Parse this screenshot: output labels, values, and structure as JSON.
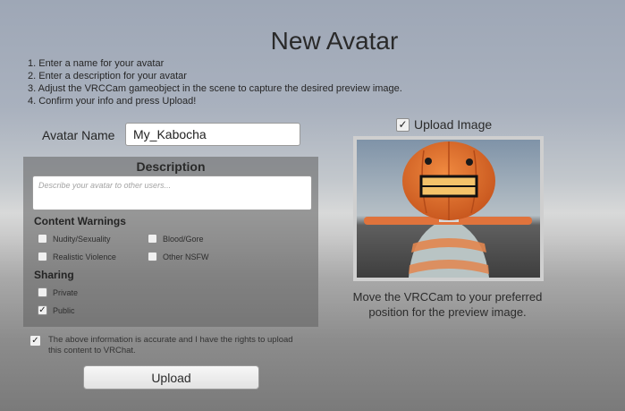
{
  "page": {
    "title": "New Avatar"
  },
  "instructions": [
    "1. Enter a name for your avatar",
    "2. Enter a description for your avatar",
    "3. Adjust the VRCCam gameobject in the scene to capture the desired preview image.",
    "4. Confirm your info and press Upload!"
  ],
  "avatar_name": {
    "label": "Avatar Name",
    "value": "My_Kabocha"
  },
  "description": {
    "title": "Description",
    "placeholder": "Describe your avatar to other users...",
    "value": ""
  },
  "content_warnings": {
    "label": "Content Warnings",
    "options": [
      {
        "label": "Nudity/Sexuality",
        "checked": false
      },
      {
        "label": "Blood/Gore",
        "checked": false
      },
      {
        "label": "Realistic Violence",
        "checked": false
      },
      {
        "label": "Other NSFW",
        "checked": false
      }
    ]
  },
  "sharing": {
    "label": "Sharing",
    "options": [
      {
        "label": "Private",
        "checked": false
      },
      {
        "label": "Public",
        "checked": true
      }
    ]
  },
  "confirmation": {
    "text": "The above information is accurate and I have the rights to upload this content to VRChat.",
    "checked": true
  },
  "upload_button": {
    "label": "Upload"
  },
  "upload_image": {
    "label": "Upload Image",
    "checked": true
  },
  "preview": {
    "caption": "Move the VRCCam to your preferred position for the preview image."
  },
  "icons": {
    "checkmark": "check-icon"
  },
  "colors": {
    "panel": "#606060",
    "input_bg": "#ffffff"
  }
}
